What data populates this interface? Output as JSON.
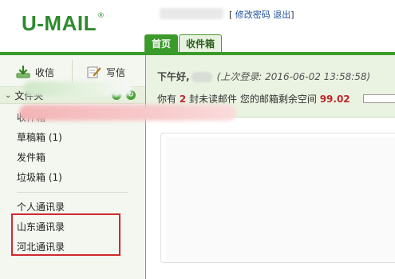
{
  "header": {
    "logo_text": "U-MAIL",
    "logo_mark": "®",
    "links": {
      "open_bracket": "[",
      "change_password": "修改密码",
      "logout": "退出",
      "close_bracket": "]"
    }
  },
  "tabs": [
    {
      "label": "首页",
      "active": true
    },
    {
      "label": "收件箱",
      "active": false
    }
  ],
  "sidebar": {
    "receive_label": "收信",
    "write_label": "写信",
    "folder_header": "文件夹",
    "folders": [
      "收件箱",
      "草稿箱 (1)",
      "发件箱",
      "垃圾箱 (1)"
    ],
    "contacts": [
      "个人通讯录",
      "山东通讯录",
      "河北通讯录"
    ]
  },
  "main": {
    "greeting": "下午好,",
    "last_login": "(上次登录: 2016-06-02 13:58:58)",
    "status_prefix": "你有",
    "unread_count": "2",
    "status_mid": "封未读邮件  您的邮箱剩余空间",
    "space_left": "99.02"
  },
  "colors": {
    "brand_green": "#3a9a2a",
    "logo_green": "#2e8b2e",
    "highlight_red": "#d2282e",
    "sidebar_bg": "#f3f7ef"
  }
}
